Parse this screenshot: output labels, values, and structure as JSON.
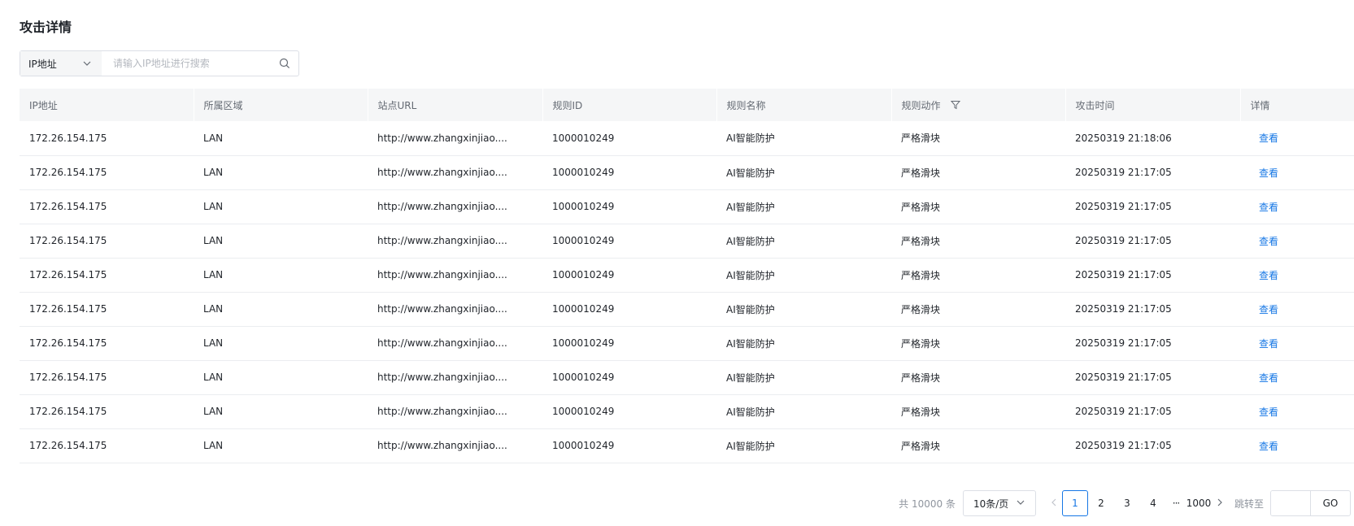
{
  "page": {
    "title": "攻击详情"
  },
  "search": {
    "field_selected": "IP地址",
    "placeholder": "请输入IP地址进行搜索",
    "value": ""
  },
  "table": {
    "columns": [
      "IP地址",
      "所属区域",
      "站点URL",
      "规则ID",
      "规则名称",
      "规则动作",
      "攻击时间",
      "详情"
    ],
    "rows": [
      {
        "ip": "172.26.154.175",
        "region": "LAN",
        "url": "http://www.zhangxinjiao....",
        "rule_id": "1000010249",
        "rule_name": "AI智能防护",
        "action": "严格滑块",
        "time": "20250319 21:18:06",
        "detail": "查看"
      },
      {
        "ip": "172.26.154.175",
        "region": "LAN",
        "url": "http://www.zhangxinjiao....",
        "rule_id": "1000010249",
        "rule_name": "AI智能防护",
        "action": "严格滑块",
        "time": "20250319 21:17:05",
        "detail": "查看"
      },
      {
        "ip": "172.26.154.175",
        "region": "LAN",
        "url": "http://www.zhangxinjiao....",
        "rule_id": "1000010249",
        "rule_name": "AI智能防护",
        "action": "严格滑块",
        "time": "20250319 21:17:05",
        "detail": "查看"
      },
      {
        "ip": "172.26.154.175",
        "region": "LAN",
        "url": "http://www.zhangxinjiao....",
        "rule_id": "1000010249",
        "rule_name": "AI智能防护",
        "action": "严格滑块",
        "time": "20250319 21:17:05",
        "detail": "查看"
      },
      {
        "ip": "172.26.154.175",
        "region": "LAN",
        "url": "http://www.zhangxinjiao....",
        "rule_id": "1000010249",
        "rule_name": "AI智能防护",
        "action": "严格滑块",
        "time": "20250319 21:17:05",
        "detail": "查看"
      },
      {
        "ip": "172.26.154.175",
        "region": "LAN",
        "url": "http://www.zhangxinjiao....",
        "rule_id": "1000010249",
        "rule_name": "AI智能防护",
        "action": "严格滑块",
        "time": "20250319 21:17:05",
        "detail": "查看"
      },
      {
        "ip": "172.26.154.175",
        "region": "LAN",
        "url": "http://www.zhangxinjiao....",
        "rule_id": "1000010249",
        "rule_name": "AI智能防护",
        "action": "严格滑块",
        "time": "20250319 21:17:05",
        "detail": "查看"
      },
      {
        "ip": "172.26.154.175",
        "region": "LAN",
        "url": "http://www.zhangxinjiao....",
        "rule_id": "1000010249",
        "rule_name": "AI智能防护",
        "action": "严格滑块",
        "time": "20250319 21:17:05",
        "detail": "查看"
      },
      {
        "ip": "172.26.154.175",
        "region": "LAN",
        "url": "http://www.zhangxinjiao....",
        "rule_id": "1000010249",
        "rule_name": "AI智能防护",
        "action": "严格滑块",
        "time": "20250319 21:17:05",
        "detail": "查看"
      },
      {
        "ip": "172.26.154.175",
        "region": "LAN",
        "url": "http://www.zhangxinjiao....",
        "rule_id": "1000010249",
        "rule_name": "AI智能防护",
        "action": "严格滑块",
        "time": "20250319 21:17:05",
        "detail": "查看"
      }
    ]
  },
  "pagination": {
    "total_text": "共 10000 条",
    "page_size": "10条/页",
    "pages": [
      "1",
      "2",
      "3",
      "4"
    ],
    "current_page": "1",
    "ellipsis": "···",
    "last_page": "1000",
    "jump_label": "跳转至",
    "jump_value": "",
    "go_label": "GO"
  },
  "colors": {
    "accent": "#1677e5",
    "header_bg": "#f5f6f7",
    "border": "#dcdfe6",
    "row_divider": "#ebedf0",
    "muted_text": "#8f959e"
  },
  "icons": {
    "search": "search-icon",
    "dropdown": "chevron-down-icon",
    "filter": "filter-icon",
    "prev": "chevron-left-icon",
    "next": "chevron-right-icon"
  }
}
